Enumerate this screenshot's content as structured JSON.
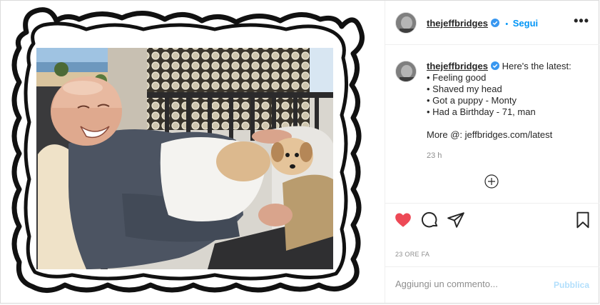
{
  "post": {
    "username": "thejeffbridges",
    "follow_label": "Segui",
    "follow_separator": "•",
    "more_label": "•••",
    "caption_lines": [
      "Here's the latest:",
      "• Feeling good",
      "• Shaved my head",
      "• Got a puppy - Monty",
      "• Had a Birthday - 71, man",
      "",
      "More @: jeffbridges.com/latest"
    ],
    "caption_time": "23 h",
    "posted_ago": "23 ORE FA",
    "comment_placeholder": "Aggiungi un commento...",
    "publish_label": "Pubblica"
  },
  "icons": {
    "verified": "verified-badge-icon",
    "add_comment": "plus-circle-icon",
    "like": "heart-filled-icon",
    "comment": "comment-bubble-icon",
    "share": "paper-plane-icon",
    "save": "bookmark-icon",
    "more": "more-options-icon"
  },
  "colors": {
    "link_blue": "#0095f6",
    "like_red": "#ed4956",
    "publish_disabled": "#b2dffc",
    "muted": "#8e8e8e"
  }
}
